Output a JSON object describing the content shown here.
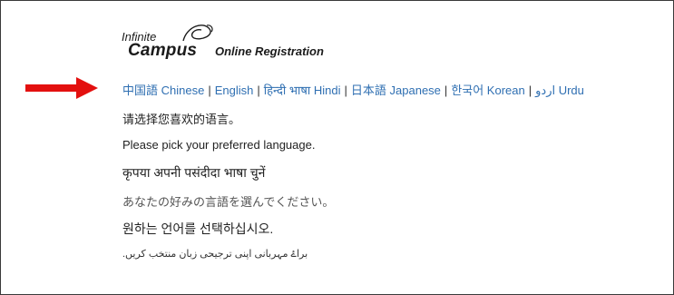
{
  "logo": {
    "word1": "Infinite",
    "word2": "Campus",
    "tagline": "Online Registration"
  },
  "languages": [
    {
      "label": "中国語 Chinese"
    },
    {
      "label": "English"
    },
    {
      "label": "हिन्दी भाषा Hindi"
    },
    {
      "label": "日本語 Japanese"
    },
    {
      "label": "한국어 Korean"
    },
    {
      "label": "اردو Urdu"
    }
  ],
  "separator": "|",
  "prompts": {
    "chinese": "请选择您喜欢的语言。",
    "english": "Please pick your preferred language.",
    "hindi": "कृपया अपनी पसंदीदा भाषा चुनें",
    "japanese": "あなたの好みの言語を選んでください。",
    "korean": "원하는 언어를 선택하십시오.",
    "urdu": "براۓ مہربانی اپنی ترجیحی زبان منتخب کریں."
  },
  "colors": {
    "link": "#2f6fb2",
    "arrow": "#e3100f",
    "border": "#3a3a3a"
  },
  "icons": {
    "arrow": "right-arrow-icon",
    "logo_swirl": "swirl-icon"
  }
}
